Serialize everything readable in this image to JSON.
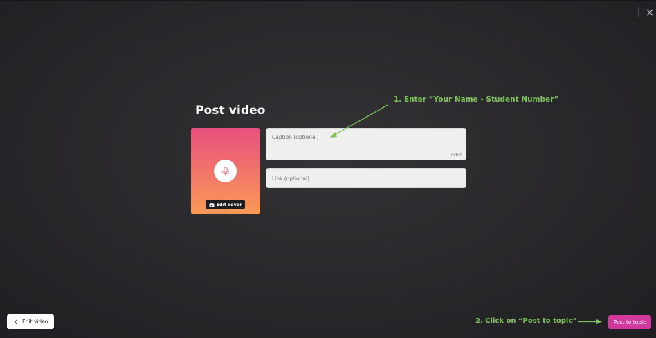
{
  "header": {
    "close_icon": "close-icon"
  },
  "main": {
    "title": "Post video",
    "cover": {
      "center_icon": "microphone-icon",
      "edit_cover_icon": "camera-icon",
      "edit_cover_label": "Edit cover"
    },
    "caption": {
      "placeholder": "Caption (optional)",
      "value": "",
      "counter": "0/100"
    },
    "link": {
      "placeholder": "Link (optional)",
      "value": ""
    }
  },
  "annotations": {
    "step1": "1. Enter “Your Name - Student Number”",
    "step2": "2. Click on “Post to topic”"
  },
  "footer": {
    "edit_video_icon": "chevron-left-icon",
    "edit_video_label": "Edit video",
    "post_label": "Post to topic"
  },
  "colors": {
    "background": "#2a292c",
    "accent_pink": "#d2399e",
    "annotation_green": "#7dc25a",
    "cover_gradient_top": "#e8507f",
    "cover_gradient_bottom": "#f99a55"
  }
}
